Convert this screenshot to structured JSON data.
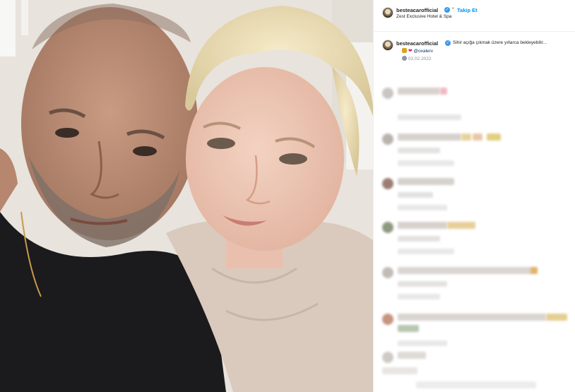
{
  "header": {
    "username": "besteacarofficial",
    "follow_label": "Takip Et",
    "location": "Zest Exclusive Hotel & Spa"
  },
  "caption": {
    "username": "besteacarofficial",
    "text": "Sihir açığa çıkmak üzere yıllarca bekleyebilir...",
    "mention": "@oxalerv",
    "date": "02.02.2022"
  },
  "colors": {
    "link_blue": "#0095f6",
    "verified_blue": "#3897f0",
    "heart_red": "#e0245e"
  },
  "icons": {
    "verified": "verified-badge-icon",
    "heart": "heart-icon"
  }
}
